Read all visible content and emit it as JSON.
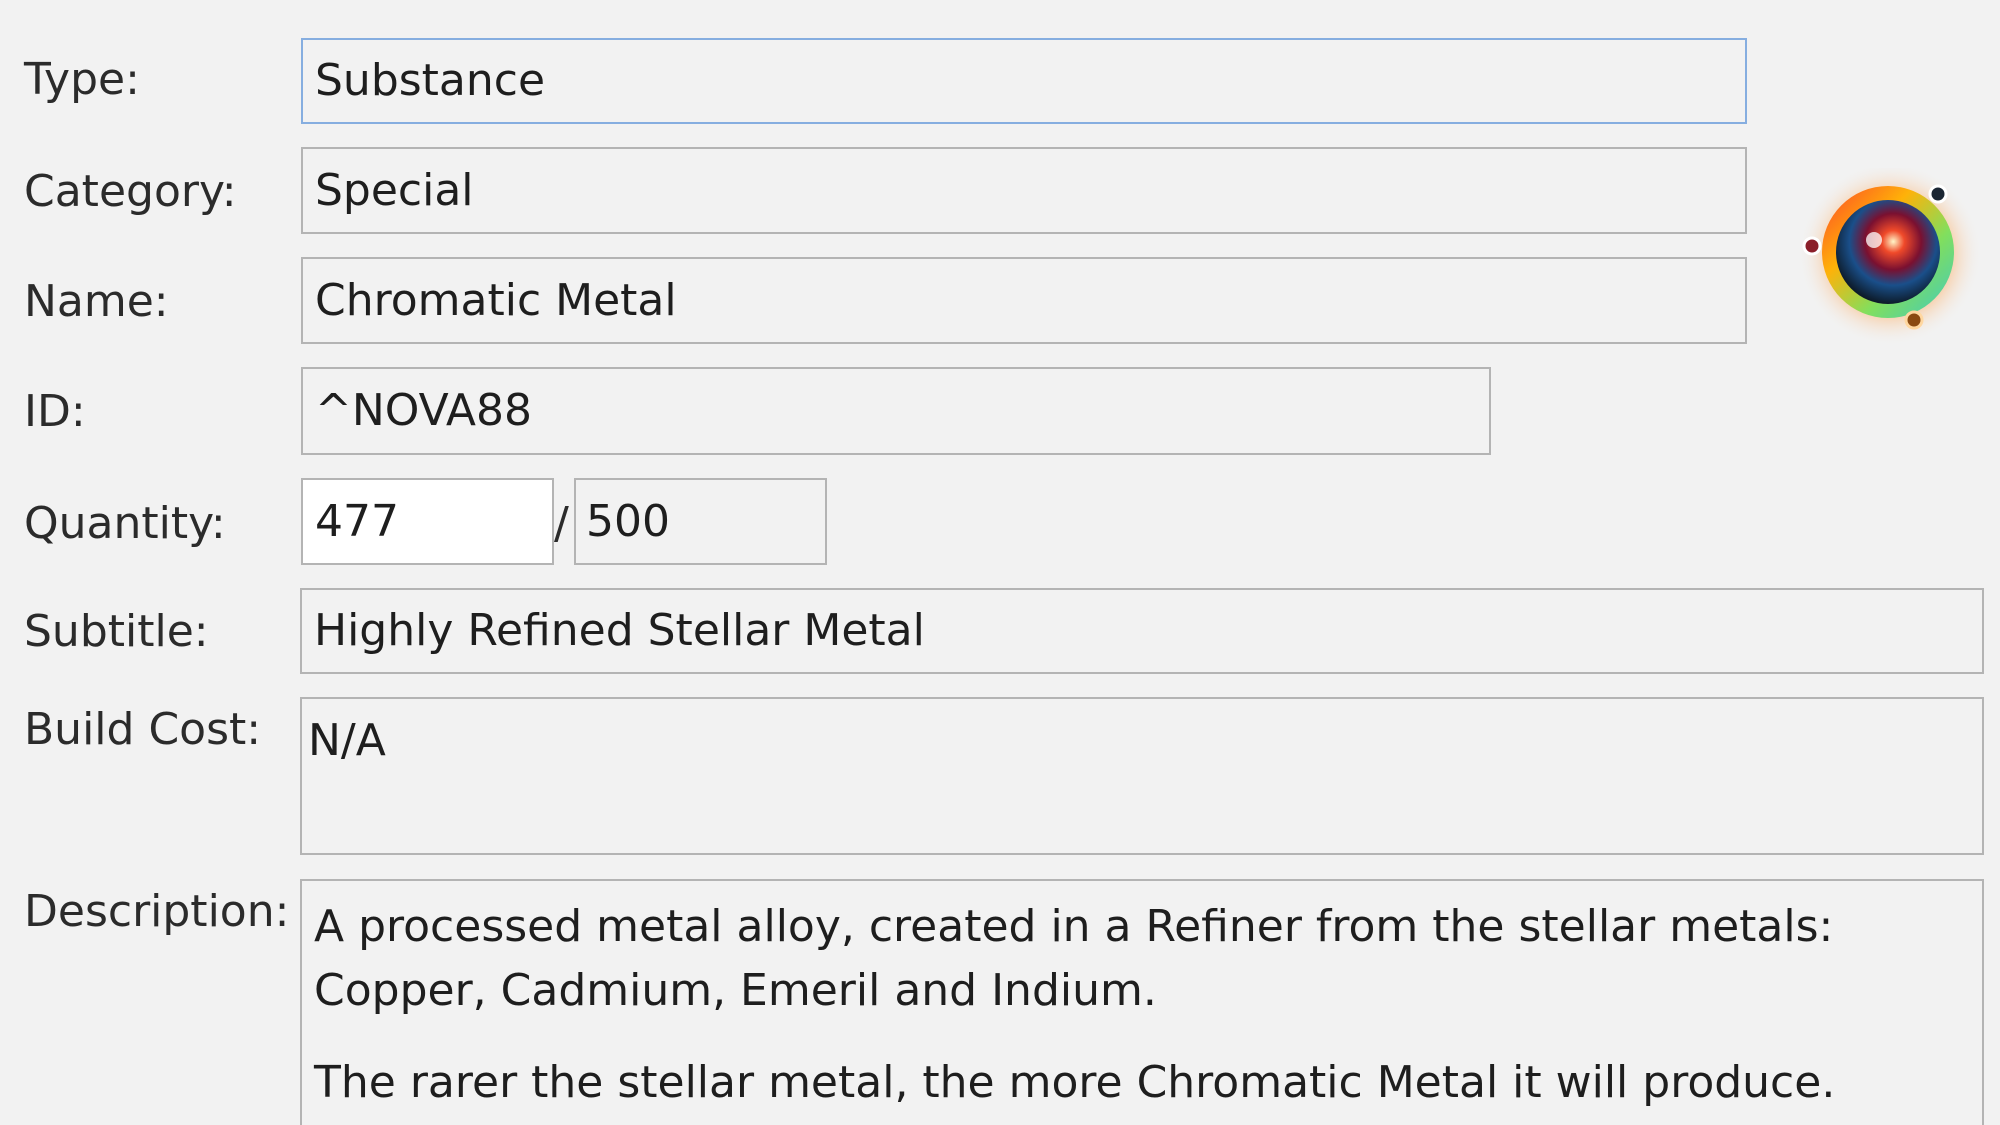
{
  "fields": {
    "type": {
      "label": "Type:",
      "value": "Substance"
    },
    "category": {
      "label": "Category:",
      "value": "Special"
    },
    "name": {
      "label": "Name:",
      "value": "Chromatic Metal"
    },
    "id": {
      "label": "ID:",
      "value": "^NOVA88"
    },
    "quantity": {
      "label": "Quantity:",
      "value": "477",
      "separator": "/",
      "max": "500"
    },
    "subtitle": {
      "label": "Subtitle:",
      "value": "Highly Refined Stellar Metal"
    },
    "build_cost": {
      "label": "Build Cost:",
      "value": "N/A"
    },
    "description": {
      "label": "Description:",
      "paragraphs": [
        "A processed metal alloy, created in a Refiner from the stellar metals: Copper, Cadmium, Emeril and Indium.",
        "The rarer the stellar metal, the more Chromatic Metal it will produce."
      ]
    }
  },
  "item_icon": {
    "name": "chromatic-metal-orb-icon"
  },
  "colors": {
    "background": "#f2f2f2",
    "border": "#b4b4b4",
    "focus_border": "#86aee0",
    "text": "#1e1e1e"
  }
}
